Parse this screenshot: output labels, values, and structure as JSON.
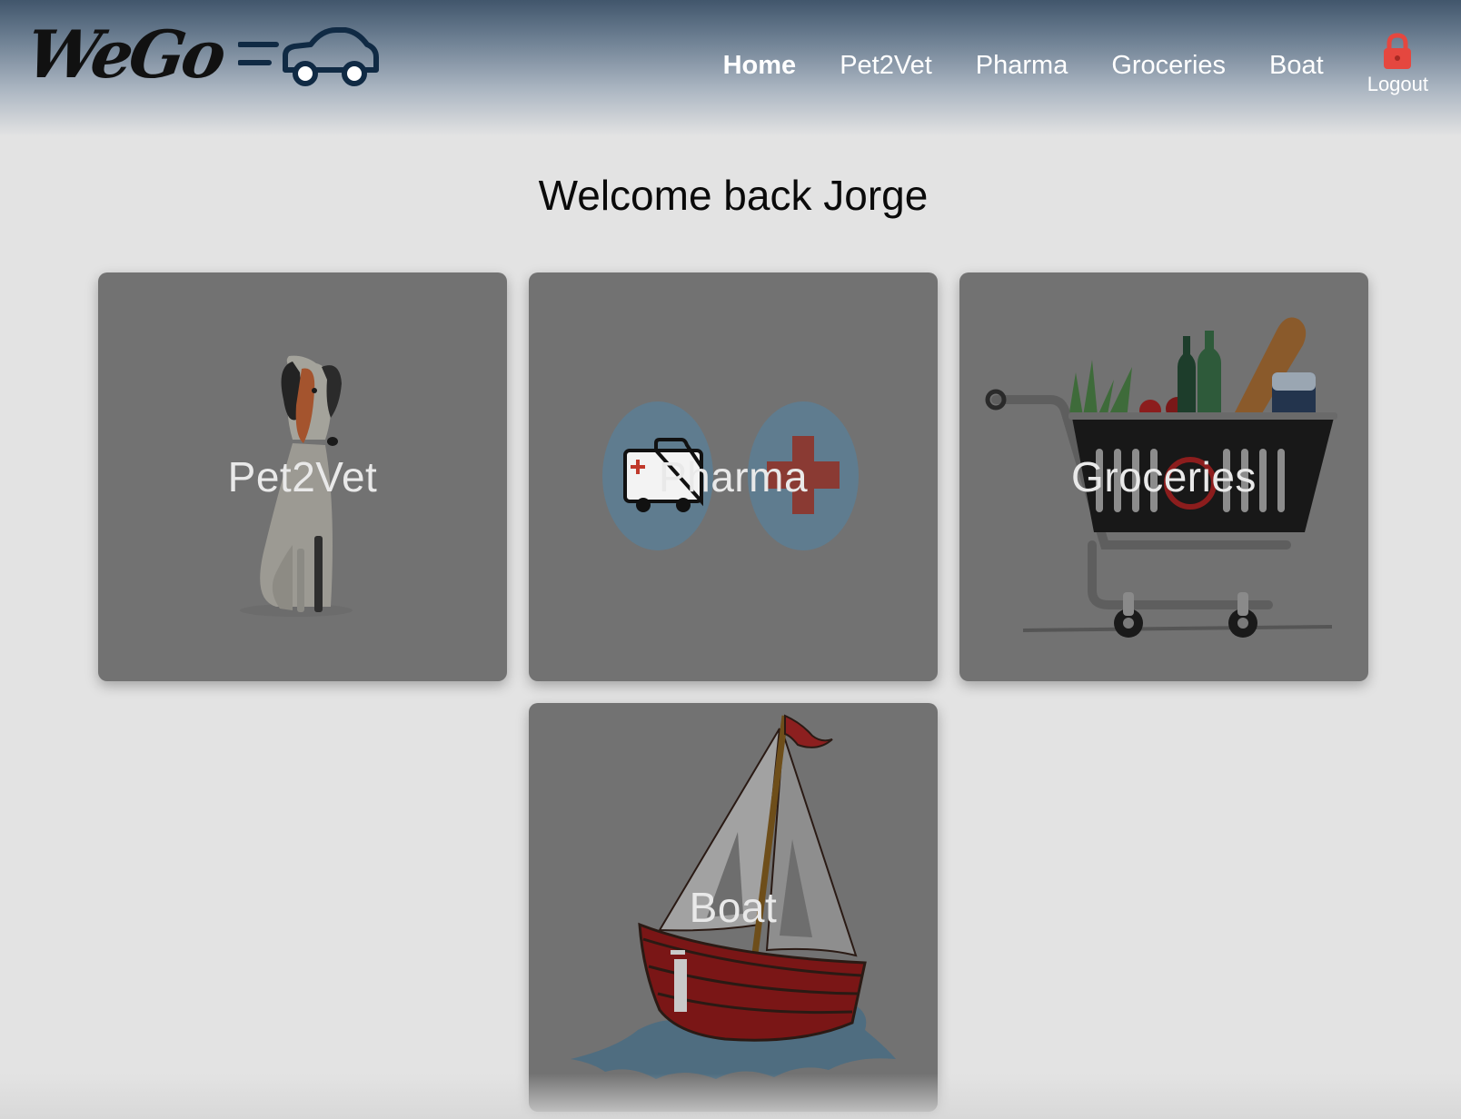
{
  "header": {
    "logo_text": "WeGo",
    "nav": [
      {
        "label": "Home",
        "active": true
      },
      {
        "label": "Pet2Vet",
        "active": false
      },
      {
        "label": "Pharma",
        "active": false
      },
      {
        "label": "Groceries",
        "active": false
      },
      {
        "label": "Boat",
        "active": false
      }
    ],
    "logout_label": "Logout",
    "logout_icon": "lock-icon",
    "logout_color": "#e5473f"
  },
  "main": {
    "welcome": "Welcome back Jorge",
    "cards": [
      {
        "label": "Pet2Vet",
        "icon": "dog-illustration"
      },
      {
        "label": "Pharma",
        "icon": "ambulance-and-cross-illustration"
      },
      {
        "label": "Groceries",
        "icon": "shopping-cart-illustration"
      },
      {
        "label": "Boat",
        "icon": "sailboat-illustration"
      }
    ]
  }
}
